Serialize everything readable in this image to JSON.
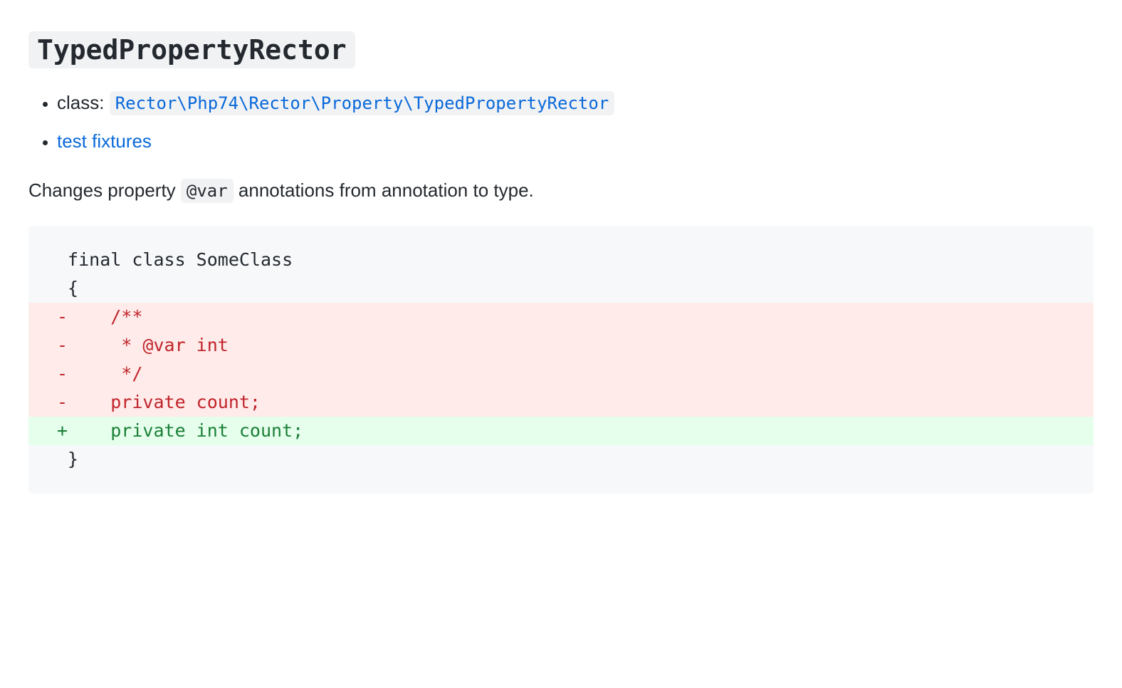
{
  "heading": "TypedPropertyRector",
  "bullets": {
    "classLabel": "class: ",
    "classPath": "Rector\\Php74\\Rector\\Property\\TypedPropertyRector",
    "fixturesLabel": "test fixtures"
  },
  "description": {
    "before": "Changes property ",
    "code": "@var",
    "after": " annotations from annotation to type."
  },
  "diff": [
    {
      "type": "ctx",
      "text": " final class SomeClass"
    },
    {
      "type": "ctx",
      "text": " {"
    },
    {
      "type": "del",
      "text": "-    /**"
    },
    {
      "type": "del",
      "text": "-     * @var int"
    },
    {
      "type": "del",
      "text": "-     */"
    },
    {
      "type": "del",
      "text": "-    private count;"
    },
    {
      "type": "add",
      "text": "+    private int count;"
    },
    {
      "type": "ctx",
      "text": " }"
    }
  ]
}
